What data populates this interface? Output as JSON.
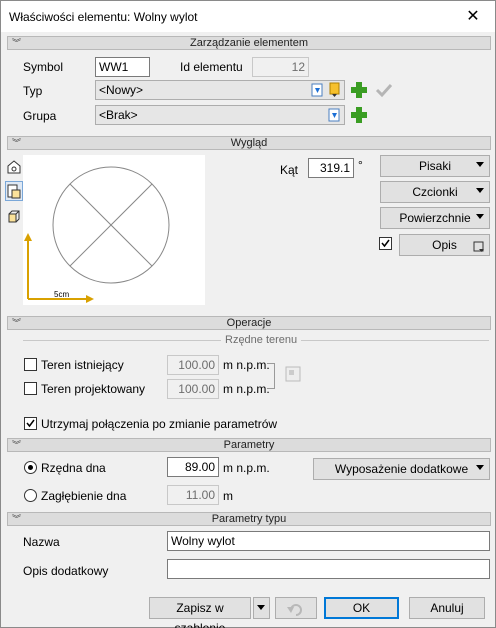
{
  "window": {
    "title": "Właściwości elementu: Wolny wylot"
  },
  "sections": {
    "zarzadzanie": "Zarządzanie elementem",
    "wyglad": "Wygląd",
    "operacje": "Operacje",
    "parametry": "Parametry",
    "parametry_typu": "Parametry typu"
  },
  "element": {
    "symbol_label": "Symbol",
    "symbol_value": "WW1",
    "id_label": "Id elementu",
    "id_value": "12",
    "typ_label": "Typ",
    "typ_value": "<Nowy>",
    "grupa_label": "Grupa",
    "grupa_value": "<Brak>"
  },
  "appearance": {
    "kat_label": "Kąt",
    "kat_value": "319.1",
    "kat_unit": "°",
    "scale_label": "5cm",
    "pisaki": "Pisaki",
    "czcionki": "Czcionki",
    "powierzchnie": "Powierzchnie",
    "opis": "Opis",
    "opis_checked": true
  },
  "operations": {
    "rzedne_terenu": "Rzędne terenu",
    "teren_istniejacy": "Teren istniejący",
    "teren_istniejacy_value": "100.00",
    "teren_projektowany": "Teren projektowany",
    "teren_projektowany_value": "100.00",
    "unit": "m n.p.m.",
    "utrzymaj": "Utrzymaj połączenia po zmianie parametrów",
    "utrzymaj_checked": true
  },
  "parameters": {
    "rzedna_dna": "Rzędna dna",
    "rzedna_dna_value": "89.00",
    "rzedna_unit": "m n.p.m.",
    "zaglebienie": "Zagłębienie dna",
    "zaglebienie_value": "11.00",
    "zaglebienie_unit": "m",
    "wyposazenie": "Wyposażenie dodatkowe",
    "selected": "Rzędna dna"
  },
  "type_params": {
    "nazwa_label": "Nazwa",
    "nazwa_value": "Wolny wylot",
    "opis_label": "Opis dodatkowy",
    "opis_value": ""
  },
  "footer": {
    "zapisz": "Zapisz w szablonie",
    "ok": "OK",
    "anuluj": "Anuluj"
  }
}
